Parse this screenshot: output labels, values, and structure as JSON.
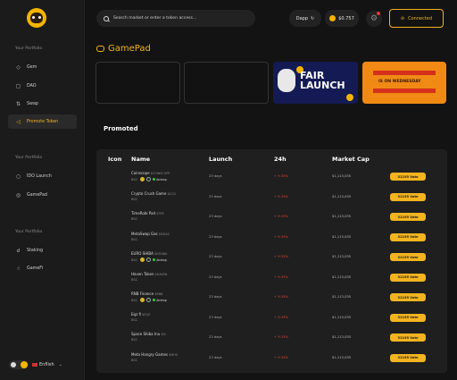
{
  "sidebar": {
    "sections": [
      "Your Portfolio",
      "Your Portfolio",
      "Your Portfolio"
    ],
    "items": [
      {
        "label": "Gem",
        "icon": "diamond-icon"
      },
      {
        "label": "DAO",
        "icon": "dao-icon"
      },
      {
        "label": "Swap",
        "icon": "swap-icon"
      },
      {
        "label": "Promote Token",
        "icon": "megaphone-icon"
      },
      {
        "label": "IDO Launch",
        "icon": "rocket-icon"
      },
      {
        "label": "GamePad",
        "icon": "gamepad-icon"
      },
      {
        "label": "Staking",
        "icon": "staking-icon"
      },
      {
        "label": "GameFi",
        "icon": "gamefi-icon"
      }
    ],
    "active_item": "Promote Token",
    "language": "Enflish"
  },
  "topbar": {
    "search_placeholder": "Search market or enter a token access...",
    "dapp_label": "Dapp",
    "balance": "$0.757",
    "connect_label": "Connected"
  },
  "gamepad": {
    "title": "GamePad",
    "banner1_text": "FAIR LAUNCH",
    "banner2_text": "IS ON WEDNESDAY"
  },
  "promoted": {
    "title": "Promoted",
    "columns": [
      "Icon",
      "Name",
      "Launch",
      "24h",
      "Market Cap"
    ],
    "rows": [
      {
        "name": "Coinscope",
        "tag": "$COINSCOPE",
        "chain": "BSC",
        "airdrop": true,
        "launch": "23 days",
        "change": "+ 9.33%",
        "cap": "$1,113,035",
        "vote": "31195 Vote"
      },
      {
        "name": "Crypto Crush Game",
        "tag": "$CCG",
        "chain": "BSC",
        "airdrop": false,
        "launch": "23 days",
        "change": "+ 9.33%",
        "cap": "$1,113,035",
        "vote": "31195 Vote"
      },
      {
        "name": "TimeRobi Pad",
        "tag": "$TRP",
        "chain": "BSC",
        "airdrop": false,
        "launch": "23 days",
        "change": "+ 9.33%",
        "cap": "$1,113,035",
        "vote": "31195 Vote"
      },
      {
        "name": "MetaSwap Gas",
        "tag": "$MGAS",
        "chain": "BSC",
        "airdrop": false,
        "launch": "23 days",
        "change": "+ 9.33%",
        "cap": "$1,113,035",
        "vote": "31195 Vote"
      },
      {
        "name": "EURO SHIBA",
        "tag": "$ESHIBA",
        "chain": "BSC",
        "airdrop": true,
        "launch": "23 days",
        "change": "+ 9.33%",
        "cap": "$1,113,035",
        "vote": "31195 Vote"
      },
      {
        "name": "Haven Token",
        "tag": "$HAVEN",
        "chain": "BSC",
        "airdrop": false,
        "launch": "23 days",
        "change": "+ 9.33%",
        "cap": "$1,113,035",
        "vote": "31195 Vote"
      },
      {
        "name": "RNB Finance",
        "tag": "$RNB",
        "chain": "BSC",
        "airdrop": true,
        "launch": "23 days",
        "change": "+ 9.33%",
        "cap": "$1,113,035",
        "vote": "31195 Vote"
      },
      {
        "name": "Eqz fi",
        "tag": "$EQZ",
        "chain": "BSC",
        "airdrop": false,
        "launch": "23 days",
        "change": "+ 9.33%",
        "cap": "$1,113,035",
        "vote": "31195 Vote"
      },
      {
        "name": "Space Shiba Inu",
        "tag": "$SI",
        "chain": "BSC",
        "airdrop": false,
        "launch": "23 days",
        "change": "+ 9.33%",
        "cap": "$1,113,035",
        "vote": "31195 Vote"
      },
      {
        "name": "Meta Hangry Games",
        "tag": "$MHG",
        "chain": "BSC",
        "airdrop": false,
        "launch": "23 days",
        "change": "+ 9.33%",
        "cap": "$1,113,035",
        "vote": "31195 Vote"
      }
    ]
  }
}
